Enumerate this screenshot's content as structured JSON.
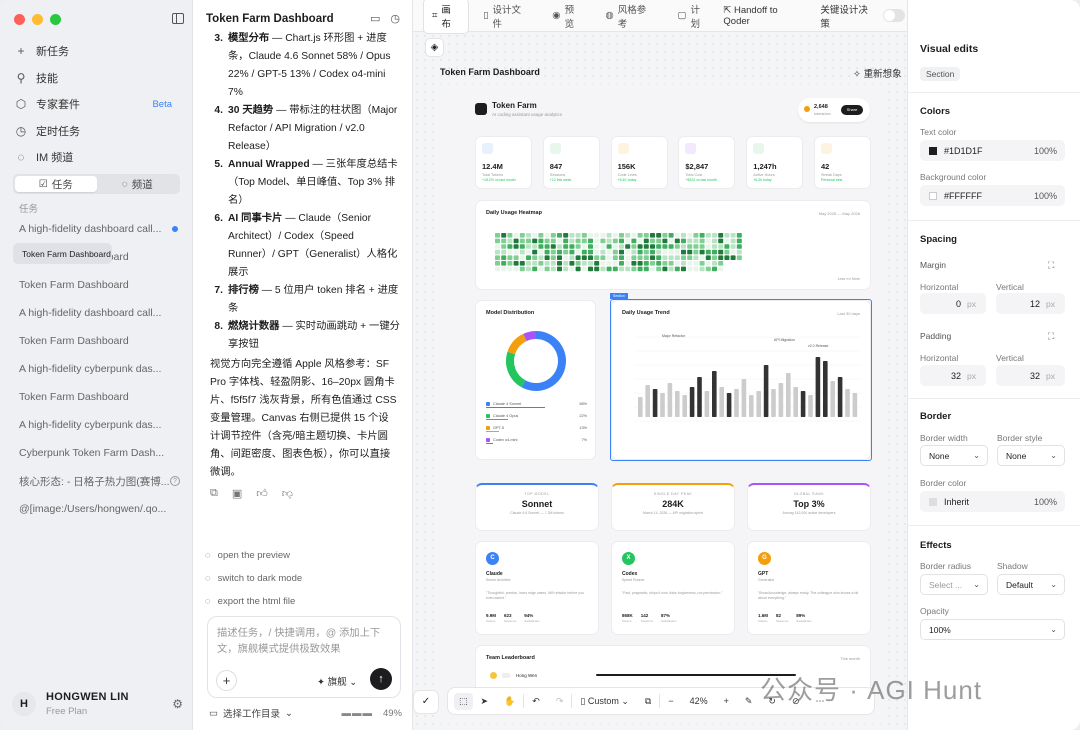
{
  "sidebar": {
    "nav": [
      {
        "icon": "plus-icon",
        "glyph": "+",
        "label": "新任务"
      },
      {
        "icon": "skills-icon",
        "glyph": "⚲",
        "label": "技能"
      },
      {
        "icon": "package-icon",
        "glyph": "⬡",
        "label": "专家套件",
        "badge": "Beta"
      },
      {
        "icon": "clock-icon",
        "glyph": "◷",
        "label": "定时任务"
      },
      {
        "icon": "chat-bubble-icon",
        "glyph": "◌",
        "label": "IM 频道"
      }
    ],
    "segments": [
      "任务",
      "频道"
    ],
    "section_label": "任务",
    "tasks": [
      "A high-fidelity dashboard call...",
      "Token Farm Dashboard",
      "Token Farm Dashboard",
      "Token Farm Dashboard",
      "A high-fidelity dashboard call...",
      "Token Farm Dashboard",
      "A high-fidelity cyberpunk das...",
      "Token Farm Dashboard",
      "A high-fidelity cyberpunk das...",
      "Cyberpunk Token Farm Dash...",
      "核心形态: - 日格子热力图(赛博...",
      "@[image:/Users/hongwen/.qo..."
    ],
    "user": {
      "initial": "H",
      "name": "HONGWEN LIN",
      "plan": "Free Plan"
    }
  },
  "chat": {
    "title": "Token Farm Dashboard",
    "list": [
      {
        "n": "3.",
        "bold": "模型分布",
        "text": " — Chart.js 环形图 + 进度条，Claude 4.6 Sonnet 58% / Opus 22% / GPT-5 13% / Codex o4-mini 7%"
      },
      {
        "n": "4.",
        "bold": "30 天趋势",
        "text": " — 带标注的柱状图（Major Refactor / API Migration / v2.0 Release）"
      },
      {
        "n": "5.",
        "bold": "Annual Wrapped",
        "text": " — 三张年度总结卡（Top Model、单日峰值、Top 3% 排名）"
      },
      {
        "n": "6.",
        "bold": "AI 同事卡片",
        "text": " — Claude（Senior Architect）/ Codex（Speed Runner）/ GPT（Generalist）人格化展示"
      },
      {
        "n": "7.",
        "bold": "排行榜",
        "text": " — 5 位用户 token 排名 + 进度条"
      },
      {
        "n": "8.",
        "bold": "燃烧计数器",
        "text": " — 实时动画跳动 + 一键分享按钮"
      }
    ],
    "paragraph": "视觉方向完全遵循 Apple 风格参考：SF Pro 字体栈、轻盈阴影、16–20px 圆角卡片、f5f5f7 浅灰背景，所有色值通过 CSS 变量管理。Canvas 右侧已提供 15 个设计调节控件（含亮/暗主题切换、卡片圆角、间距密度、图表色板），你可以直接微调。",
    "suggestions": [
      "open the preview",
      "switch to dark mode",
      "export the html file"
    ],
    "composer_placeholder": "描述任务，/ 快捷调用，@ 添加上下文，旗舰模式提供极致效果",
    "mode": "旗舰",
    "workdir": "选择工作目录",
    "context_pct": "49%"
  },
  "toolbar": {
    "tabs": [
      "画布",
      "设计文件",
      "预览",
      "风格参考",
      "计划"
    ],
    "handoff": "Handoff to Qoder",
    "key_decisions": "关键设计决策"
  },
  "canvas": {
    "frame_title": "Token Farm Dashboard",
    "rethink": "重新想象",
    "zoom_mode": "Custom",
    "zoom": "42%"
  },
  "dashboard": {
    "title": "Token Farm",
    "subtitle": "AI coding assistant usage analytics",
    "burn_value": "2,648",
    "burn_label": "tokens/sec",
    "share": "Share",
    "stats": [
      {
        "value": "12.4M",
        "label": "Total Tokens",
        "delta": "+18.2% vs last month",
        "color": "#3b82f6",
        "bg": "#e8f0fe"
      },
      {
        "value": "847",
        "label": "Sessions",
        "delta": "+12 this week",
        "color": "#22c55e",
        "bg": "#e7f7ec"
      },
      {
        "value": "156K",
        "label": "Code Lines",
        "delta": "+8.4K today",
        "color": "#f59e0b",
        "bg": "#fdf3e1"
      },
      {
        "value": "$2,847",
        "label": "Total Cost",
        "delta": "+$324 vs last month",
        "color": "#a855f7",
        "bg": "#f3e8fe"
      },
      {
        "value": "1,247h",
        "label": "Active Hours",
        "delta": "+6.2h today",
        "color": "#22c55e",
        "bg": "#e7f7ec"
      },
      {
        "value": "42",
        "label": "Streak Days",
        "delta": "Personal best",
        "color": "#f59e0b",
        "bg": "#fdf3e1"
      }
    ],
    "heatmap": {
      "title": "Daily Usage Heatmap",
      "range": "May 2025 — May 2026",
      "less": "Less",
      "more": "More"
    },
    "distribution": {
      "title": "Model Distribution",
      "items": [
        {
          "name": "Claude 4 Sonnet",
          "pct": "58%",
          "value": 58,
          "color": "#3b82f6"
        },
        {
          "name": "Claude 4 Opus",
          "pct": "22%",
          "value": 22,
          "color": "#22c55e"
        },
        {
          "name": "GPT-5",
          "pct": "13%",
          "value": 13,
          "color": "#f59e0b"
        },
        {
          "name": "Codex o4-mini",
          "pct": "7%",
          "value": 7,
          "color": "#a855f7"
        }
      ]
    },
    "trend": {
      "title": "Daily Usage Trend",
      "range": "Last 30 days",
      "tag": "Section",
      "annotations": [
        "Major Refactor",
        "API Migration",
        "v2.0 Release"
      ]
    },
    "summaries": [
      {
        "top": "TOP MODEL",
        "big": "Sonnet",
        "small": "Claude 4.6 Sonnet — 7.2M tokens",
        "accent": "#3b82f6"
      },
      {
        "top": "SINGLE DAY PEAK",
        "big": "284K",
        "small": "March 14, 2026 — API migration sprint",
        "accent": "#f59e0b"
      },
      {
        "top": "GLOBAL RANK",
        "big": "Top 3%",
        "small": "Among 142,000 active developers",
        "accent": "#a855f7"
      }
    ],
    "agents": [
      {
        "initial": "C",
        "name": "Claude",
        "role": "Senior Architect",
        "quote": "Thoughtful, precise, loves edge cases. Will refactor before you even asked.",
        "stats": [
          [
            "9.9M",
            "Tokens"
          ],
          [
            "623",
            "Sessions"
          ],
          [
            "94%",
            "Satisfaction"
          ]
        ],
        "color": "#3b82f6"
      },
      {
        "initial": "X",
        "name": "Codex",
        "role": "Speed Runner",
        "quote": "Fast, pragmatic, ships it now. Asks forgiveness, not permission.",
        "stats": [
          [
            "868K",
            "Tokens"
          ],
          [
            "142",
            "Sessions"
          ],
          [
            "87%",
            "Satisfaction"
          ]
        ],
        "color": "#22c55e"
      },
      {
        "initial": "G",
        "name": "GPT",
        "role": "Generalist",
        "quote": "Broad knowledge, always ready. The colleague who knows a bit about everything.",
        "stats": [
          [
            "1.6M",
            "Tokens"
          ],
          [
            "82",
            "Sessions"
          ],
          [
            "89%",
            "Satisfaction"
          ]
        ],
        "color": "#f59e0b"
      }
    ],
    "leaderboard": {
      "title": "Team Leaderboard",
      "range": "This month",
      "first": "Hong Wen"
    }
  },
  "inspector": {
    "title": "Visual edits",
    "tag": "Section",
    "colors": {
      "heading": "Colors",
      "text_label": "Text color",
      "text_value": "#1D1D1F",
      "text_opacity": "100%",
      "bg_label": "Background color",
      "bg_value": "#FFFFFF",
      "bg_opacity": "100%"
    },
    "spacing": {
      "heading": "Spacing",
      "margin": "Margin",
      "padding": "Padding",
      "horizontal": "Horizontal",
      "vertical": "Vertical",
      "margin_h": "0",
      "margin_v": "12",
      "padding_h": "32",
      "padding_v": "32",
      "unit": "px"
    },
    "border": {
      "heading": "Border",
      "width_label": "Border width",
      "style_label": "Border style",
      "width": "None",
      "style": "None",
      "color_label": "Border color",
      "color": "Inherit",
      "color_opacity": "100%"
    },
    "effects": {
      "heading": "Effects",
      "radius_label": "Border radius",
      "radius": "Select ...",
      "shadow_label": "Shadow",
      "shadow": "Default",
      "opacity_label": "Opacity",
      "opacity": "100%"
    }
  },
  "watermark": "公众号 · AGI Hunt"
}
